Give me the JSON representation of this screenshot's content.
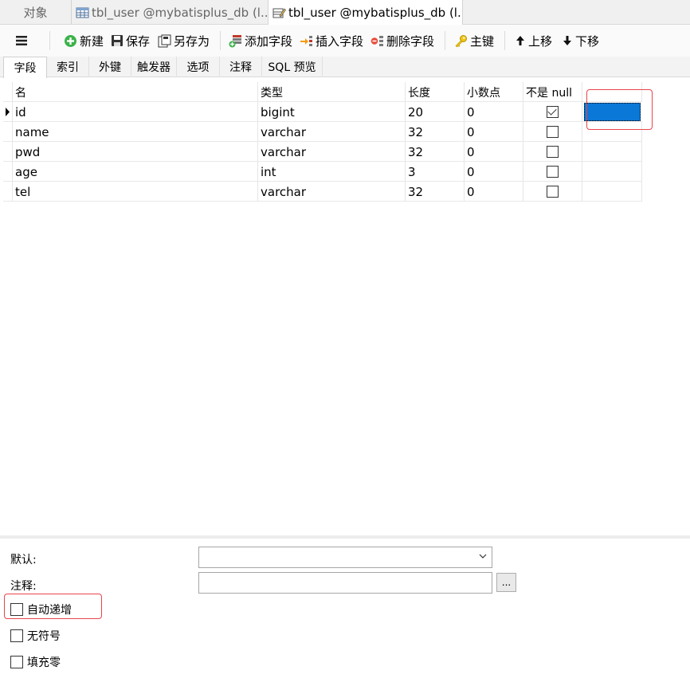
{
  "tabs": {
    "objects": "对象",
    "tab1": "tbl_user @mybatisplus_db (l...",
    "tab2": "tbl_user @mybatisplus_db (l..."
  },
  "toolbar": {
    "new": "新建",
    "save": "保存",
    "save_as": "另存为",
    "add_field": "添加字段",
    "insert_field": "插入字段",
    "delete_field": "删除字段",
    "primary_key": "主键",
    "move_up": "上移",
    "move_down": "下移"
  },
  "subtabs": [
    "字段",
    "索引",
    "外键",
    "触发器",
    "选项",
    "注释",
    "SQL 预览"
  ],
  "grid": {
    "headers": [
      "名",
      "类型",
      "长度",
      "小数点",
      "不是 null"
    ],
    "rows": [
      {
        "name": "id",
        "type": "bigint",
        "length": "20",
        "decimals": "0",
        "not_null": true
      },
      {
        "name": "name",
        "type": "varchar",
        "length": "32",
        "decimals": "0",
        "not_null": false
      },
      {
        "name": "pwd",
        "type": "varchar",
        "length": "32",
        "decimals": "0",
        "not_null": false
      },
      {
        "name": "age",
        "type": "int",
        "length": "3",
        "decimals": "0",
        "not_null": false
      },
      {
        "name": "tel",
        "type": "varchar",
        "length": "32",
        "decimals": "0",
        "not_null": false
      }
    ]
  },
  "form": {
    "default_label": "默认:",
    "comment_label": "注释:",
    "ellipsis": "...",
    "auto_increment": "自动递增",
    "unsigned": "无符号",
    "zerofill": "填充零"
  },
  "colors": {
    "selection": "#0a78d7",
    "highlight_box": "#e8454a"
  }
}
